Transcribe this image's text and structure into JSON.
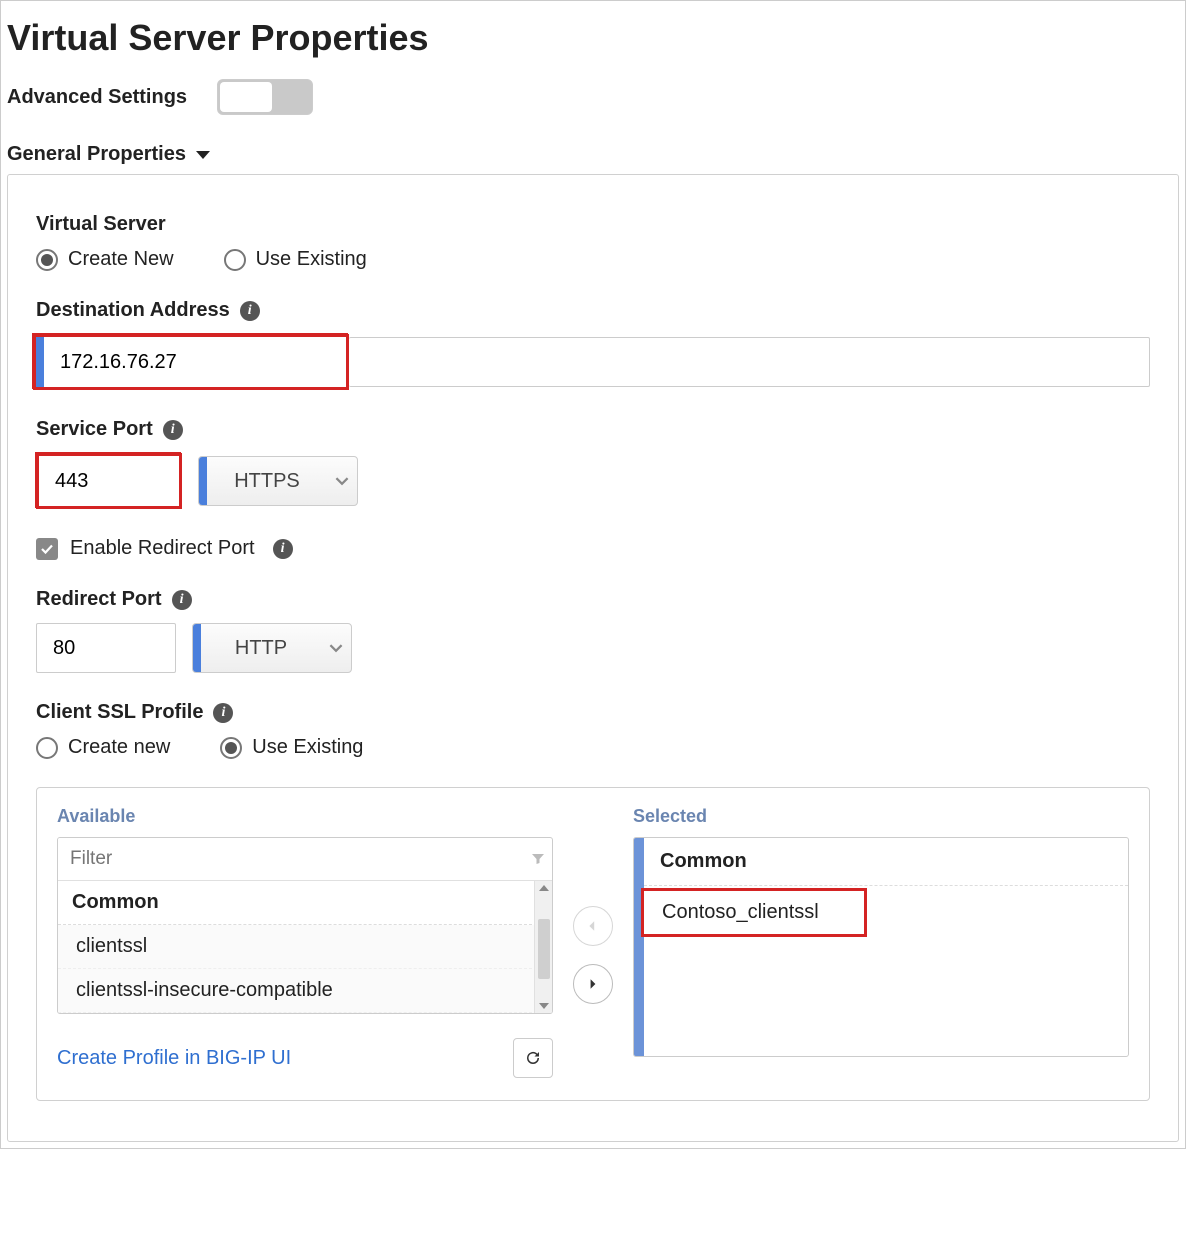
{
  "page_title": "Virtual Server Properties",
  "advanced_settings": {
    "label": "Advanced Settings",
    "on": false
  },
  "section_general": "General Properties",
  "virtual_server": {
    "label": "Virtual Server",
    "create_new": "Create New",
    "use_existing": "Use Existing",
    "selected": "create_new"
  },
  "destination": {
    "label": "Destination Address",
    "value": "172.16.76.27"
  },
  "service_port": {
    "label": "Service Port",
    "value": "443",
    "protocol": "HTTPS"
  },
  "enable_redirect": {
    "label": "Enable Redirect Port",
    "checked": true
  },
  "redirect_port": {
    "label": "Redirect Port",
    "value": "80",
    "protocol": "HTTP"
  },
  "client_ssl": {
    "label": "Client SSL Profile",
    "create_new": "Create new",
    "use_existing": "Use Existing",
    "selected": "use_existing",
    "available_label": "Available",
    "selected_label": "Selected",
    "filter_placeholder": "Filter",
    "group_name": "Common",
    "available": [
      "clientssl",
      "clientssl-insecure-compatible"
    ],
    "selected_items": [
      "Contoso_clientssl"
    ],
    "create_profile_link": "Create Profile in BIG-IP UI"
  }
}
